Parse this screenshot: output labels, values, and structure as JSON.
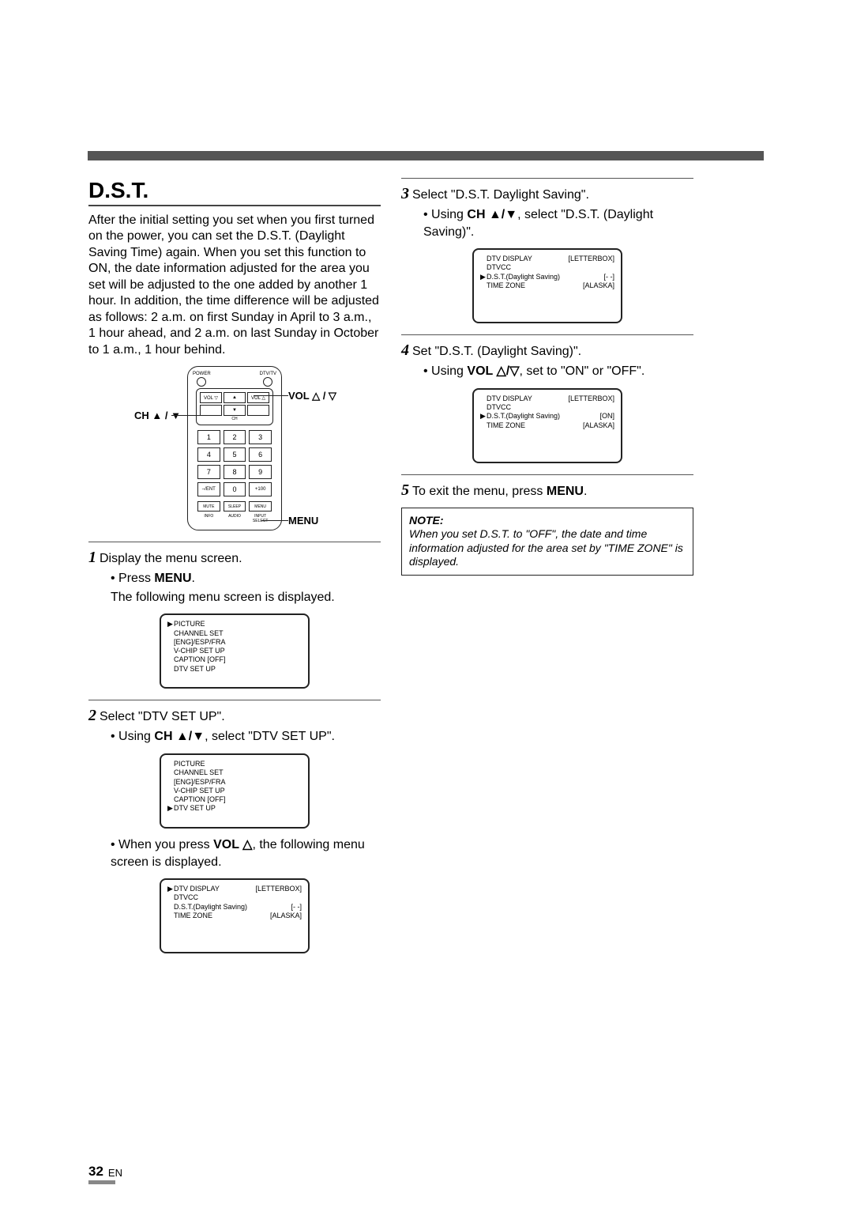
{
  "page_number": "32",
  "page_lang": "EN",
  "title": "D.S.T.",
  "intro": "After the initial setting you set when you first turned on the power, you can set the D.S.T. (Daylight Saving Time) again. When you set this function to ON, the date information adjusted for the area you set will be adjusted to the one added by another 1 hour. In addition, the time difference will be adjusted as follows: 2 a.m. on first Sunday in April to 3 a.m., 1 hour ahead, and 2 a.m. on last Sunday in October to 1 a.m., 1 hour behind.",
  "remote": {
    "labels": {
      "power": "POWER",
      "dtvtv": "DTV/TV",
      "vol": "VOL",
      "ch": "CH",
      "ent": "–/ENT",
      "plus100": "+100",
      "mute": "MUTE",
      "sleep": "SLEEP",
      "menu": "MENU",
      "info": "INFO",
      "audio": "AUDIO",
      "input": "INPUT SELECT"
    },
    "numbers": [
      "1",
      "2",
      "3",
      "4",
      "5",
      "6",
      "7",
      "8",
      "9",
      "0"
    ],
    "callouts": {
      "vol": "VOL △ / ▽",
      "ch": "CH ▲ / ▼",
      "menu": "MENU"
    }
  },
  "steps_left": [
    {
      "num": "1",
      "text": "Display the menu screen."
    },
    {
      "bullet": "• Press ",
      "bold": "MENU",
      "after": "."
    },
    {
      "plain": "The following menu screen is displayed."
    }
  ],
  "menu1": {
    "items": [
      "PICTURE",
      "CHANNEL SET",
      "[ENG]/ESP/FRA",
      "V-CHIP SET UP",
      "CAPTION [OFF]",
      "DTV SET UP"
    ],
    "pointer": 0
  },
  "step2": {
    "num": "2",
    "text": "Select \"DTV SET UP\"."
  },
  "step2_bullet": {
    "pre": "• Using ",
    "bold": "CH ▲/▼",
    "after": ", select \"DTV SET UP\"."
  },
  "menu2": {
    "items": [
      "PICTURE",
      "CHANNEL SET",
      "[ENG]/ESP/FRA",
      "V-CHIP SET UP",
      "CAPTION [OFF]",
      "DTV SET UP"
    ],
    "pointer": 5
  },
  "vol_note": {
    "pre": "• When you press ",
    "bold": "VOL △",
    "after": ", the following menu screen is displayed."
  },
  "menu3": {
    "rows": [
      {
        "label": "DTV DISPLAY",
        "val": "[LETTERBOX]",
        "ptr": true
      },
      {
        "label": "DTVCC",
        "val": ""
      },
      {
        "label": "D.S.T.(Daylight Saving)",
        "val": "[- -]"
      },
      {
        "label": "TIME ZONE",
        "val": "[ALASKA]"
      }
    ]
  },
  "step3": {
    "num": "3",
    "text": "Select \"D.S.T. Daylight Saving\"."
  },
  "step3_bullet": {
    "pre": "• Using ",
    "bold": "CH ▲/▼",
    "after": ", select \"D.S.T. (Daylight Saving)\"."
  },
  "menu4": {
    "rows": [
      {
        "label": "DTV DISPLAY",
        "val": "[LETTERBOX]"
      },
      {
        "label": "DTVCC",
        "val": ""
      },
      {
        "label": "D.S.T.(Daylight Saving)",
        "val": "[- -]",
        "ptr": true
      },
      {
        "label": "TIME ZONE",
        "val": "[ALASKA]"
      }
    ]
  },
  "step4": {
    "num": "4",
    "text": "Set \"D.S.T. (Daylight Saving)\"."
  },
  "step4_bullet": {
    "pre": "• Using ",
    "bold": "VOL △/▽",
    "after": ", set to \"ON\" or \"OFF\"."
  },
  "menu5": {
    "rows": [
      {
        "label": "DTV DISPLAY",
        "val": "[LETTERBOX]"
      },
      {
        "label": "DTVCC",
        "val": ""
      },
      {
        "label": "D.S.T.(Daylight Saving)",
        "val": "[ON]",
        "ptr": true
      },
      {
        "label": "TIME ZONE",
        "val": "[ALASKA]"
      }
    ]
  },
  "step5": {
    "num": "5",
    "pre": "To exit the menu, press ",
    "bold": "MENU",
    "after": "."
  },
  "note": {
    "label": "NOTE:",
    "body": "When you set D.S.T. to \"OFF\", the date and time information adjusted for the area set by \"TIME ZONE\" is displayed."
  }
}
